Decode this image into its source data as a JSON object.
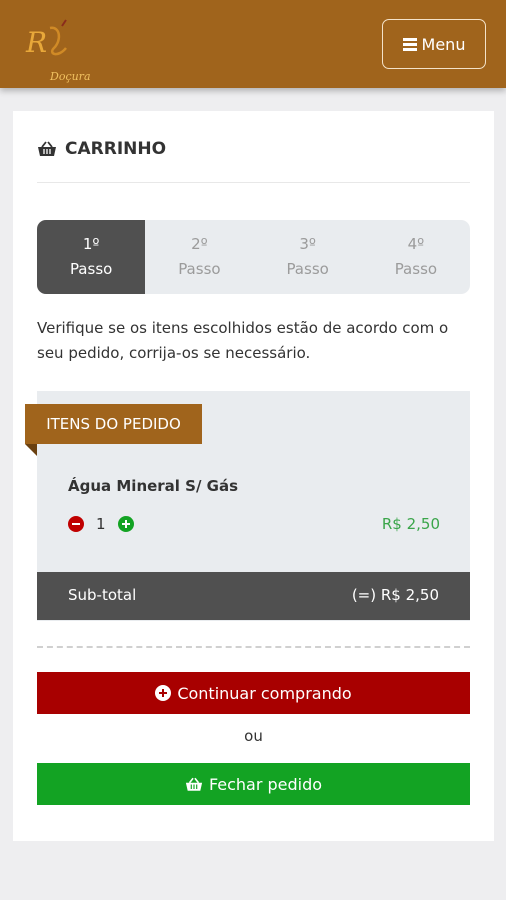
{
  "header": {
    "logo_text": "Doçura",
    "menu_label": "Menu"
  },
  "cart": {
    "title": "CARRINHO",
    "steps": [
      {
        "number": "1º",
        "label": "Passo",
        "active": true
      },
      {
        "number": "2º",
        "label": "Passo",
        "active": false
      },
      {
        "number": "3º",
        "label": "Passo",
        "active": false
      },
      {
        "number": "4º",
        "label": "Passo",
        "active": false
      }
    ],
    "intro": "Verifique se os itens escolhidos estão de acordo com o seu pedido, corrija-os se necessário.",
    "order_ribbon": "ITENS DO PEDIDO",
    "item": {
      "name": "Água Mineral S/ Gás",
      "quantity": "1",
      "price": "R$ 2,50"
    },
    "subtotal_label": "Sub-total",
    "subtotal_value": "(=) R$ 2,50",
    "continue_label": "Continuar comprando",
    "or_label": "ou",
    "close_label": "Fechar pedido"
  },
  "colors": {
    "brand": "#a0641c",
    "danger": "#a80000",
    "success": "#13a323",
    "dark": "#505050"
  }
}
